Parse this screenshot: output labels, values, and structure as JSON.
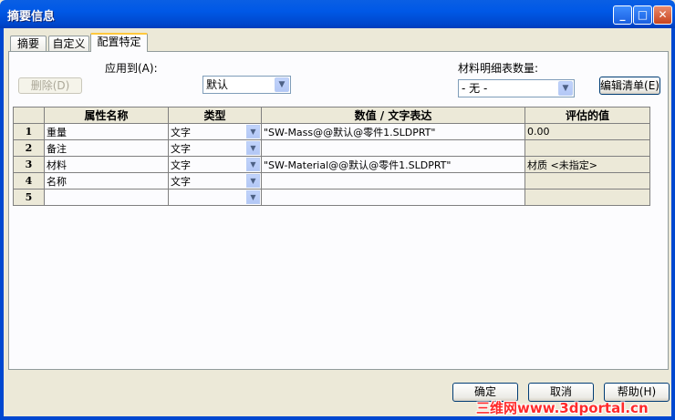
{
  "window": {
    "title": "摘要信息",
    "minimize": "_",
    "maximize": "□",
    "close": "✕"
  },
  "tabs": [
    {
      "label": "摘要"
    },
    {
      "label": "自定义"
    },
    {
      "label": "配置特定",
      "active": true
    }
  ],
  "config": {
    "apply_to_label": "应用到(A):",
    "apply_to_value": "默认",
    "delete_label": "删除(D)",
    "bom_qty_label": "材料明细表数量:",
    "bom_qty_value": "- 无 -",
    "edit_list_label": "编辑清单(E)"
  },
  "table": {
    "headers": [
      "",
      "属性名称",
      "类型",
      "数值 / 文字表达",
      "评估的值"
    ],
    "rows": [
      {
        "num": "1",
        "name": "重量",
        "type": "文字",
        "value": "\"SW-Mass@@默认@零件1.SLDPRT\"",
        "evaluated": "0.00"
      },
      {
        "num": "2",
        "name": "备注",
        "type": "文字",
        "value": "",
        "evaluated": ""
      },
      {
        "num": "3",
        "name": "材料",
        "type": "文字",
        "value": "\"SW-Material@@默认@零件1.SLDPRT\"",
        "evaluated": "材质 <未指定>"
      },
      {
        "num": "4",
        "name": "名称",
        "type": "文字",
        "value": "",
        "evaluated": ""
      },
      {
        "num": "5",
        "name": "",
        "type": "",
        "value": "",
        "evaluated": ""
      }
    ]
  },
  "footer": {
    "ok": "确定",
    "cancel": "取消",
    "help": "帮助(H)"
  },
  "watermark": "三维网www.3dportal.cn",
  "colors": {
    "titlebar": "#0058e6",
    "dialog_bg": "#ece9d8",
    "active_tab_accent": "#ffc83c"
  }
}
